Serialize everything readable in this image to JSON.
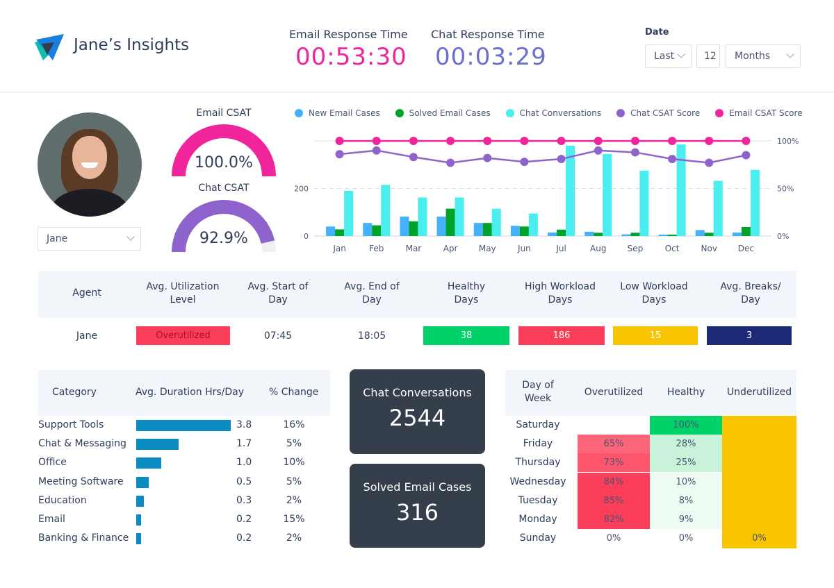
{
  "header": {
    "brand": "Jane’s Insights",
    "email_response": {
      "label": "Email Response Time",
      "value": "00:53:30",
      "color": "#f0259b"
    },
    "chat_response": {
      "label": "Chat Response Time",
      "value": "00:03:29",
      "color": "#6b6fcf"
    },
    "date": {
      "label": "Date",
      "range_select": "Last",
      "count": "12",
      "unit_select": "Months"
    }
  },
  "agent_select": {
    "value": "Jane"
  },
  "gauges": [
    {
      "title": "Email CSAT",
      "value_text": "100.0%",
      "value": 1.0,
      "color": "#f0259b"
    },
    {
      "title": "Chat CSAT",
      "value_text": "92.9%",
      "value": 0.929,
      "color": "#8f63cc"
    }
  ],
  "chart_data": {
    "type": "bar",
    "title": "",
    "categories": [
      "Jan",
      "Feb",
      "Mar",
      "Apr",
      "May",
      "Jun",
      "Jul",
      "Aug",
      "Sep",
      "Oct",
      "Nov",
      "Dec"
    ],
    "series": [
      {
        "name": "New Email Cases",
        "kind": "bar",
        "axis": "left",
        "color": "#45b1fb",
        "values": [
          40,
          55,
          82,
          82,
          55,
          43,
          15,
          18,
          7,
          6,
          25,
          15
        ]
      },
      {
        "name": "Solved Email Cases",
        "kind": "bar",
        "axis": "left",
        "color": "#00a32a",
        "values": [
          28,
          45,
          62,
          115,
          55,
          40,
          27,
          14,
          14,
          6,
          14,
          38
        ]
      },
      {
        "name": "Chat Conversations",
        "kind": "bar",
        "axis": "left",
        "color": "#4aeeee",
        "values": [
          190,
          215,
          162,
          162,
          115,
          95,
          380,
          345,
          275,
          385,
          232,
          278
        ]
      },
      {
        "name": "Chat CSAT Score",
        "kind": "line",
        "axis": "right",
        "color": "#8f63cc",
        "values": [
          86,
          90,
          83,
          77,
          82,
          78,
          81,
          90,
          88,
          81,
          77,
          85
        ]
      },
      {
        "name": "Email CSAT Score",
        "kind": "line",
        "axis": "right",
        "color": "#f0259b",
        "values": [
          100,
          100,
          100,
          100,
          100,
          100,
          100,
          100,
          100,
          100,
          100,
          100
        ]
      }
    ],
    "left_axis": {
      "ticks": [
        "0",
        "200"
      ],
      "range": [
        0,
        400
      ]
    },
    "right_axis": {
      "ticks": [
        "0%",
        "50%",
        "100%"
      ],
      "range": [
        0,
        100
      ]
    },
    "legend_position": "top",
    "grid": true
  },
  "agent_table": {
    "headers": [
      "Agent",
      "Avg. Utilization Level",
      "Avg. Start of Day",
      "Avg. End of Day",
      "Healthy Days",
      "High Workload Days",
      "Low Workload Days",
      "Avg. Breaks/ Day"
    ],
    "row": {
      "agent": "Jane",
      "utilization": {
        "text": "Overutilized",
        "color": "#fc3d5a"
      },
      "start": "07:45",
      "end": "18:05",
      "healthy": {
        "text": "38",
        "color": "#00d26a"
      },
      "high": {
        "text": "186",
        "color": "#fc3d5a"
      },
      "low": {
        "text": "15",
        "color": "#f9c400"
      },
      "breaks": {
        "text": "3",
        "color": "#1c2a78"
      }
    }
  },
  "category_table": {
    "headers": [
      "Category",
      "Avg. Duration Hrs/Day",
      "% Change"
    ],
    "max": 3.8,
    "rows": [
      {
        "category": "Support Tools",
        "duration": 3.8,
        "duration_text": "3.8",
        "change": "16%"
      },
      {
        "category": "Chat & Messaging",
        "duration": 1.7,
        "duration_text": "1.7",
        "change": "5%"
      },
      {
        "category": "Office",
        "duration": 1.0,
        "duration_text": "1.0",
        "change": "10%"
      },
      {
        "category": "Meeting Software",
        "duration": 0.5,
        "duration_text": "0.5",
        "change": "5%"
      },
      {
        "category": "Education",
        "duration": 0.3,
        "duration_text": "0.3",
        "change": "2%"
      },
      {
        "category": "Email",
        "duration": 0.2,
        "duration_text": "0.2",
        "change": "15%"
      },
      {
        "category": "Banking & Finance",
        "duration": 0.2,
        "duration_text": "0.2",
        "change": "2%"
      }
    ]
  },
  "kpis": [
    {
      "label": "Chat Conversations",
      "value": "2544"
    },
    {
      "label": "Solved Email Cases",
      "value": "316"
    }
  ],
  "heatmap": {
    "headers": [
      "Day of Week",
      "Overutilized",
      "Healthy",
      "Underutilized"
    ],
    "rows": [
      {
        "day": "Saturday",
        "over": "",
        "healthy": "100%",
        "under": ""
      },
      {
        "day": "Friday",
        "over": "65%",
        "healthy": "28%",
        "under": ""
      },
      {
        "day": "Thursday",
        "over": "73%",
        "healthy": "25%",
        "under": ""
      },
      {
        "day": "Wednesday",
        "over": "84%",
        "healthy": "10%",
        "under": ""
      },
      {
        "day": "Tuesday",
        "over": "85%",
        "healthy": "8%",
        "under": ""
      },
      {
        "day": "Monday",
        "over": "82%",
        "healthy": "9%",
        "under": ""
      },
      {
        "day": "Sunday",
        "over": "0%",
        "healthy": "0%",
        "under": "0%"
      }
    ],
    "colors": {
      "over": [
        "",
        "#fd6679",
        "#fd566d",
        "#fc3d5a",
        "#fc3d5a",
        "#fc3d5a",
        ""
      ],
      "healthy": [
        "#00d26a",
        "#c8f3da",
        "#c8f3da",
        "#edfbf2",
        "#edfbf2",
        "#edfbf2",
        ""
      ],
      "under": [
        "#f9c400",
        "#f9c400",
        "#f9c400",
        "#f9c400",
        "#f9c400",
        "#f9c400",
        "#f9c400"
      ]
    }
  }
}
